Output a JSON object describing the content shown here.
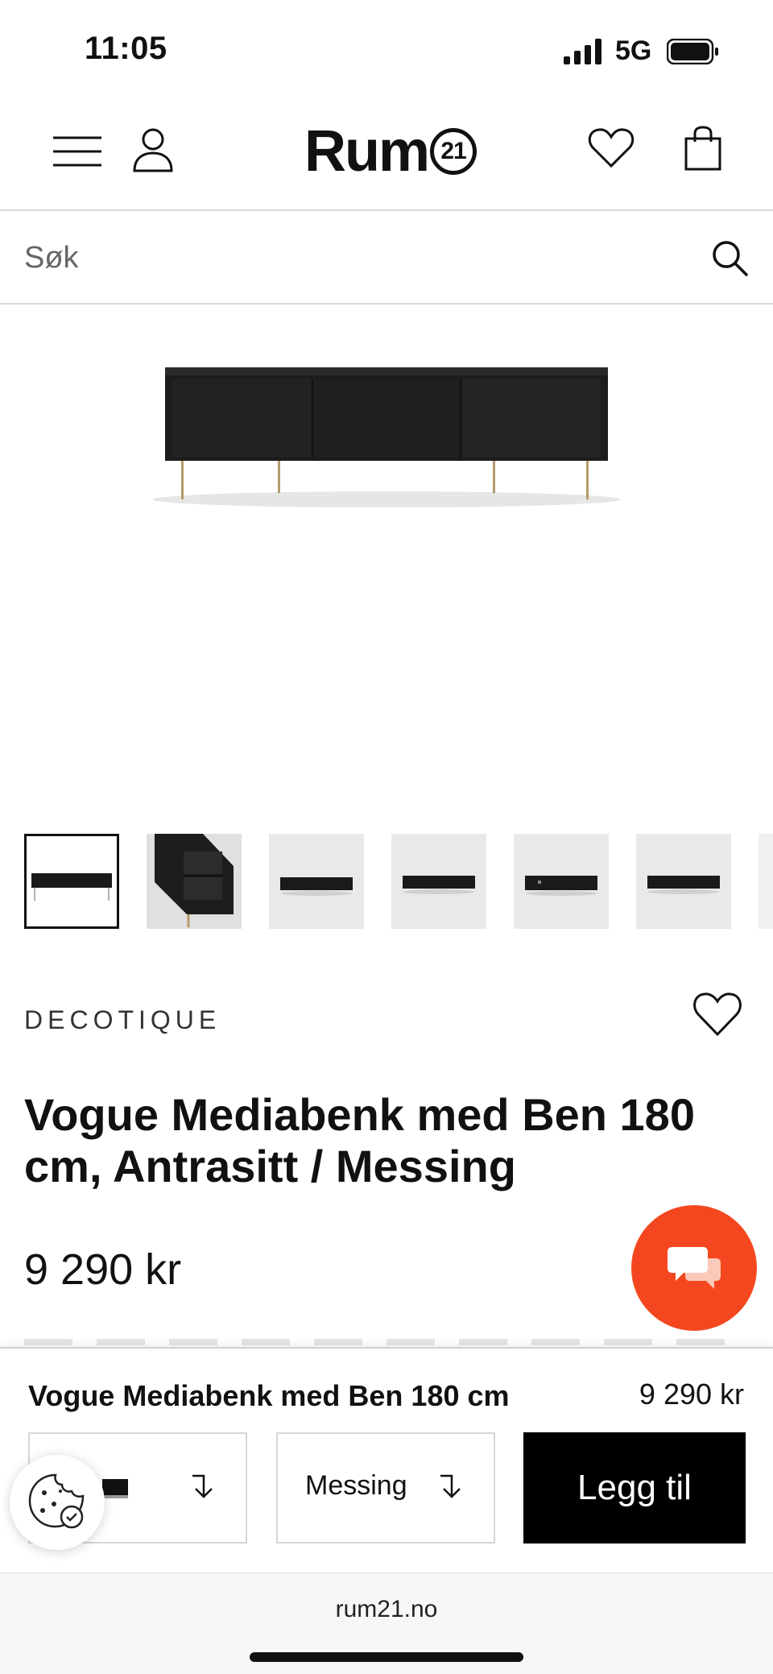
{
  "status_bar": {
    "time": "11:05",
    "network": "5G"
  },
  "header": {
    "logo_text": "Rum",
    "logo_number": "21"
  },
  "search": {
    "placeholder": "Søk"
  },
  "product": {
    "brand": "DECOTIQUE",
    "title": "Vogue Mediabenk med Ben 180 cm, Antrasitt / Messing",
    "price": "9 290 kr"
  },
  "sticky_bar": {
    "title": "Vogue Mediabenk med Ben 180 cm",
    "price": "9 290 kr",
    "color_select": "",
    "leg_select": "Messing",
    "add_button": "Legg til"
  },
  "browser": {
    "url": "rum21.no"
  },
  "colors": {
    "chat_accent": "#f5471f",
    "button_black": "#000000"
  },
  "icons": [
    "menu-icon",
    "user-icon",
    "heart-icon",
    "bag-icon",
    "search-icon",
    "chat-icon",
    "cookie-icon",
    "chevron-down-icon"
  ]
}
